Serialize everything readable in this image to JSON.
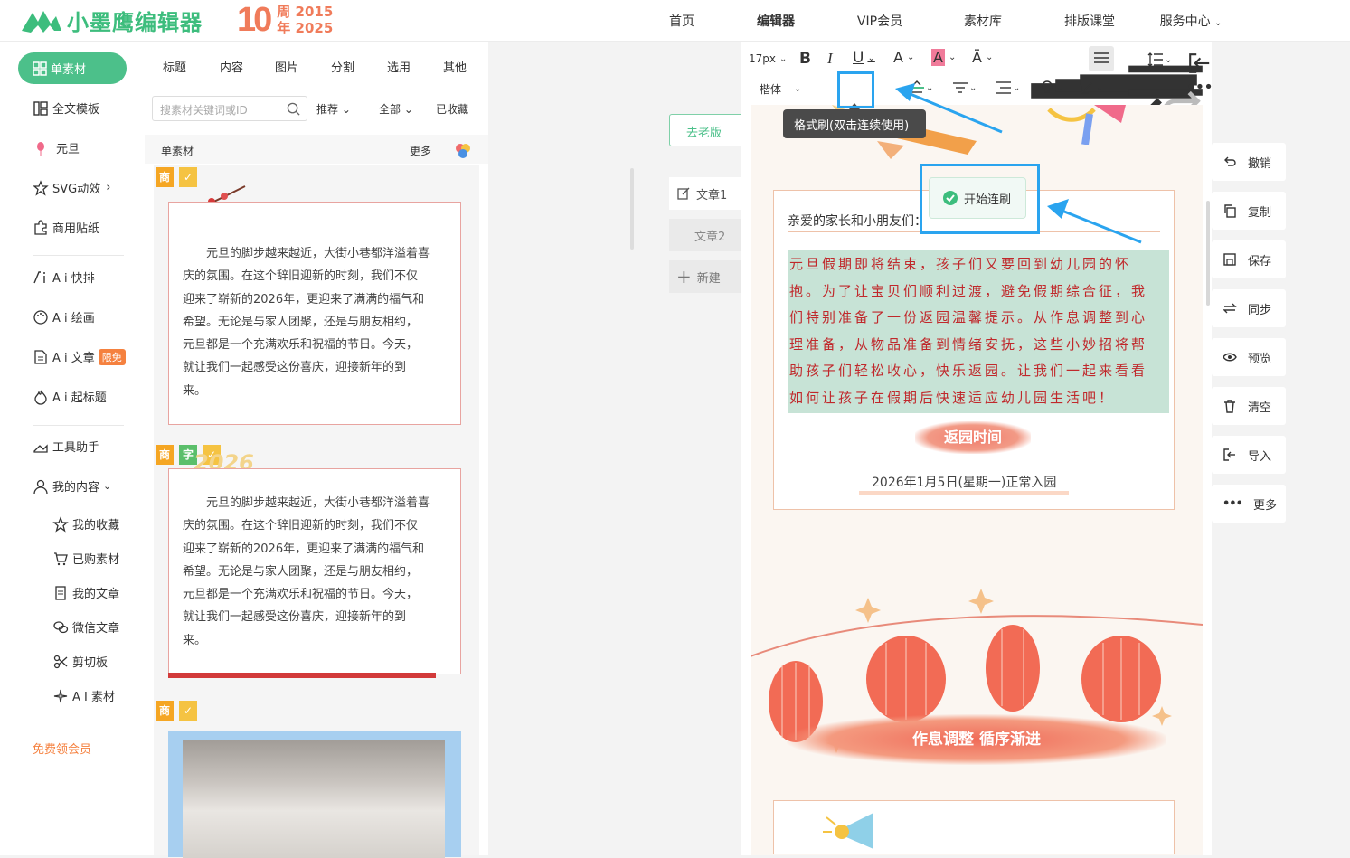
{
  "header": {
    "logo_text": "小墨鹰编辑器",
    "anniversary": {
      "number": "10",
      "label": "周",
      "year_start": "2015",
      "label2": "年",
      "year_end": "2025"
    },
    "nav": [
      "首页",
      "编辑器",
      "VIP会员",
      "素材库",
      "排版课堂",
      "服务中心"
    ]
  },
  "sidebar": {
    "active": "单素材",
    "items": [
      "全文模板",
      "元旦",
      "SVG动效",
      "商用贴纸",
      "A i 快排",
      "A i 绘画",
      "A i 文章",
      "A i 起标题",
      "工具助手",
      "我的内容"
    ],
    "ai_article_badge": "限免",
    "sub_items": [
      "我的收藏",
      "已购素材",
      "我的文章",
      "微信文章",
      "剪切板",
      "A I 素材"
    ],
    "vip": "免费领会员"
  },
  "materials": {
    "categories": [
      "标题",
      "内容",
      "图片",
      "分割",
      "选用",
      "其他"
    ],
    "search_placeholder": "搜素材关键词或ID",
    "filter_sort": "推荐",
    "filter_all": "全部",
    "collected": "已收藏",
    "section_title": "单素材",
    "more": "更多",
    "tags": {
      "business": "商",
      "font": "字"
    },
    "card_text": "元旦的脚步越来越近，大街小巷都洋溢着喜庆的氛围。在这个辞旧迎新的时刻，我们不仅迎来了崭新的2026年，更迎来了满满的福气和希望。无论是与家人团聚，还是与朋友相约，元旦都是一个充满欢乐和祝福的节日。今天，就让我们一起感受这份喜庆，迎接新年的到来。",
    "card_lines": [
      "元旦的脚步越来越近，大街小巷都洋溢着喜",
      "庆的氛围。在这个辞旧迎新的时刻，我们不仅",
      "迎来了崭新的2026年，更迎来了满满的福气和",
      "希望。无论是与家人团聚，还是与朋友相约，",
      "元旦都是一个充满欢乐和祝福的节日。今天，",
      "就让我们一起感受这份喜庆，迎接新年的到",
      "来。"
    ],
    "card2_deco": "2026"
  },
  "middle": {
    "go_old": "去老版",
    "articles": [
      "文章1",
      "文章2"
    ],
    "new": "新建"
  },
  "toolbar": {
    "font_size": "17px",
    "font_family": "楷体",
    "tooltip": "格式刷(双击连续使用)",
    "start_brush": "开始连刷"
  },
  "content": {
    "greeting": "亲爱的家长和小朋友们：",
    "para_lines": [
      "元旦假期即将结束，孩子们又要回到幼儿园的怀",
      "抱。为了让宝贝们顺利过渡，避免假期综合征，我",
      "们特别准备了一份返园温馨提示。从作息调整到心",
      "理准备，从物品准备到情绪安抚，这些小妙招将帮",
      "助孩子们轻松收心，快乐返园。让我们一起来看看",
      "如何让孩子在假期后快速适应幼儿园生活吧！"
    ],
    "back_title": "返园时间",
    "date": "2026年1月5日(星期一)正常入园",
    "banner2": "作息调整  循序渐进"
  },
  "actions": [
    "撤销",
    "复制",
    "保存",
    "同步",
    "预览",
    "清空",
    "导入",
    "更多"
  ],
  "colors": {
    "brand": "#4cc08a",
    "highlight": "#2aa4ef",
    "accent": "#f07b5a",
    "text_red": "#c0282b"
  }
}
